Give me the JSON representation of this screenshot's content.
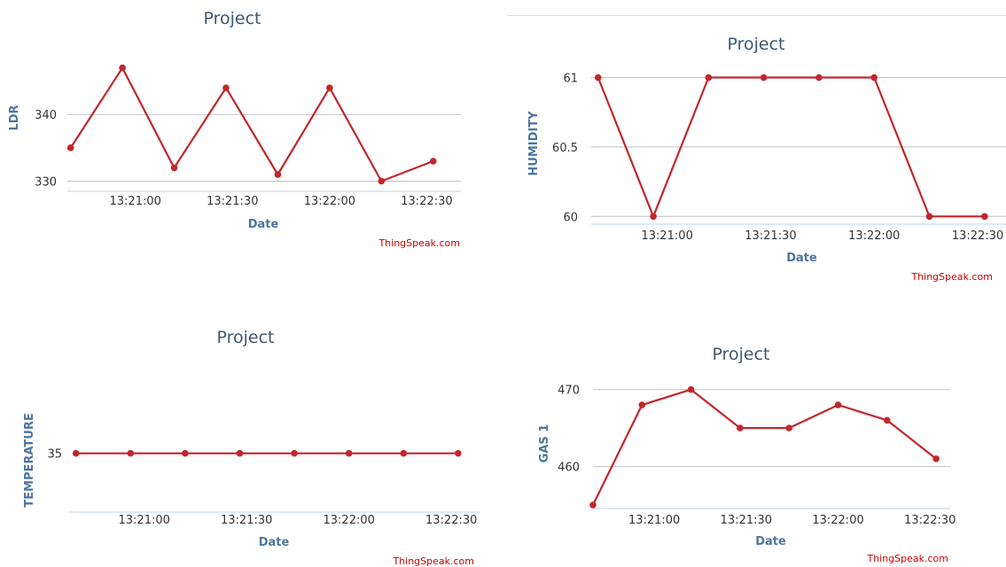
{
  "colors": {
    "series": "#c1272d"
  },
  "chart_data": [
    {
      "type": "line",
      "title": "Project",
      "xlabel": "Date",
      "ylabel": "LDR",
      "credit": "ThingSpeak.com",
      "x_ticks": [
        "13:21:00",
        "13:21:30",
        "13:22:00",
        "13:22:30"
      ],
      "y_ticks": [
        "330",
        "340"
      ],
      "xlim": [
        "13:20:39",
        "13:22:40"
      ],
      "ylim": [
        329,
        350
      ],
      "grid": true,
      "x": [
        "13:20:40",
        "13:20:56",
        "13:21:12",
        "13:21:28",
        "13:21:44",
        "13:22:00",
        "13:22:16",
        "13:22:32"
      ],
      "values": [
        335,
        347,
        332,
        344,
        331,
        344,
        330,
        333
      ]
    },
    {
      "type": "line",
      "title": "Project",
      "xlabel": "Date",
      "ylabel": "HUMIDITY",
      "credit": "ThingSpeak.com",
      "x_ticks": [
        "13:21:00",
        "13:21:30",
        "13:22:00",
        "13:22:30"
      ],
      "y_ticks": [
        "60",
        "60.5",
        "61"
      ],
      "xlim": [
        "13:20:38",
        "13:22:40"
      ],
      "ylim": [
        59.97,
        61.08
      ],
      "grid": true,
      "x": [
        "13:20:40",
        "13:20:56",
        "13:21:12",
        "13:21:28",
        "13:21:44",
        "13:22:00",
        "13:22:16",
        "13:22:32"
      ],
      "values": [
        61,
        60,
        61,
        61,
        61,
        61,
        60,
        60
      ]
    },
    {
      "type": "line",
      "title": "Project",
      "xlabel": "Date",
      "ylabel": "TEMPERATURE",
      "credit": "ThingSpeak.com",
      "x_ticks": [
        "13:21:00",
        "13:21:30",
        "13:22:00",
        "13:22:30"
      ],
      "y_ticks": [
        "35"
      ],
      "xlim": [
        "13:20:38",
        "13:22:38"
      ],
      "ylim": [
        34.2,
        35.6
      ],
      "grid": false,
      "x": [
        "13:20:40",
        "13:20:56",
        "13:21:12",
        "13:21:28",
        "13:21:44",
        "13:22:00",
        "13:22:16",
        "13:22:32"
      ],
      "values": [
        35,
        35,
        35,
        35,
        35,
        35,
        35,
        35
      ]
    },
    {
      "type": "line",
      "title": "Project",
      "xlabel": "Date",
      "ylabel": "GAS 1",
      "credit": "ThingSpeak.com",
      "x_ticks": [
        "13:21:00",
        "13:21:30",
        "13:22:00",
        "13:22:30"
      ],
      "y_ticks": [
        "460",
        "470"
      ],
      "xlim": [
        "13:20:40",
        "13:22:36"
      ],
      "ylim": [
        455,
        471
      ],
      "grid": true,
      "x": [
        "13:20:40",
        "13:20:56",
        "13:21:12",
        "13:21:28",
        "13:21:44",
        "13:22:00",
        "13:22:16",
        "13:22:32"
      ],
      "values": [
        455,
        468,
        470,
        465,
        465,
        468,
        466,
        461
      ]
    }
  ]
}
